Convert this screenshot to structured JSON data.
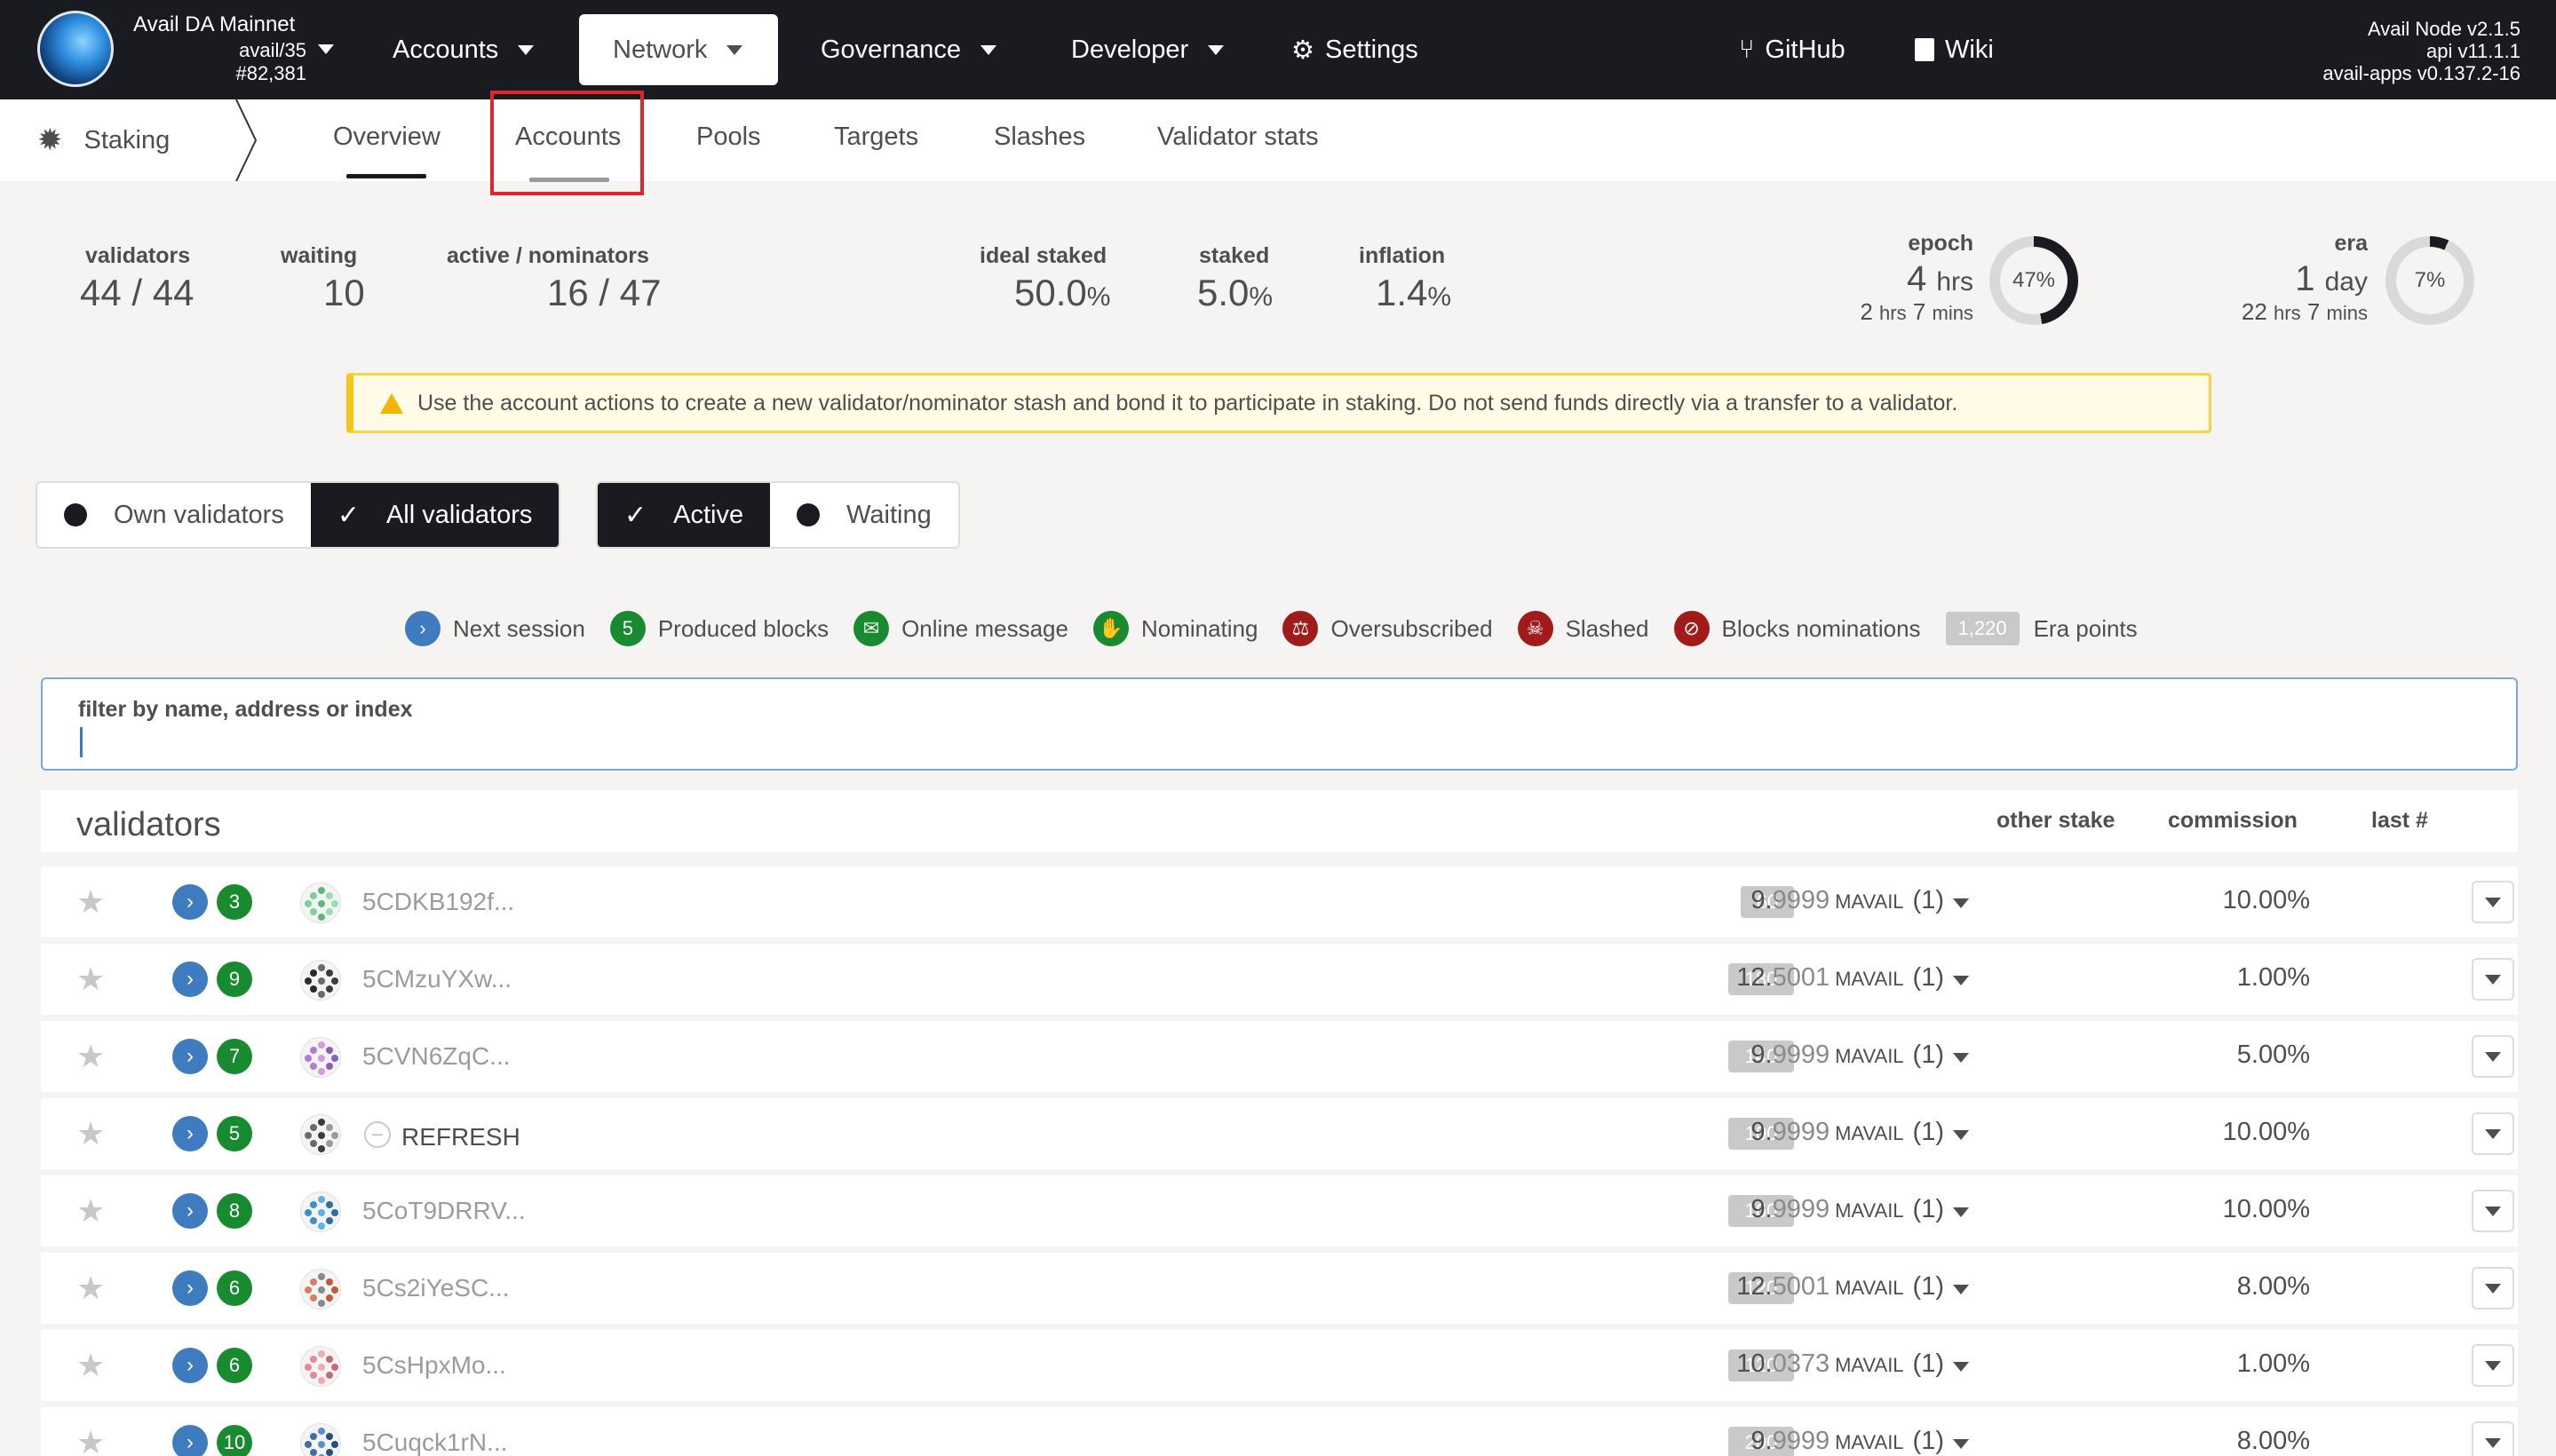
{
  "topbar": {
    "chain_name": "Avail DA Mainnet",
    "chain_spec": "avail/35",
    "block": "#82,381",
    "menu": {
      "accounts": "Accounts",
      "network": "Network",
      "governance": "Governance",
      "developer": "Developer",
      "settings": "Settings",
      "github": "GitHub",
      "wiki": "Wiki"
    },
    "version": {
      "node": "Avail Node v2.1.5",
      "api": "api v11.1.1",
      "apps": "avail-apps v0.137.2-16"
    }
  },
  "subnav": {
    "title": "Staking",
    "tabs": {
      "overview": "Overview",
      "accounts": "Accounts",
      "pools": "Pools",
      "targets": "Targets",
      "slashes": "Slashes",
      "validator_stats": "Validator stats"
    }
  },
  "summary": {
    "validators": {
      "label": "validators",
      "value": "44 / 44"
    },
    "waiting": {
      "label": "waiting",
      "value": "10"
    },
    "active_nominators": {
      "label": "active / nominators",
      "value": "16 / 47"
    },
    "ideal_staked": {
      "label": "ideal staked",
      "value": "50.0",
      "unit": "%"
    },
    "staked": {
      "label": "staked",
      "value": "5.0",
      "unit": "%"
    },
    "inflation": {
      "label": "inflation",
      "value": "1.4",
      "unit": "%"
    },
    "epoch": {
      "label": "epoch",
      "value": "4",
      "unit": "hrs",
      "sub_h": "2",
      "sub_h_unit": "hrs",
      "sub_m": "7",
      "sub_m_unit": "mins",
      "percent_text": "47%",
      "percent": 47
    },
    "era": {
      "label": "era",
      "value": "1",
      "unit": "day",
      "sub_h": "22",
      "sub_h_unit": "hrs",
      "sub_m": "7",
      "sub_m_unit": "mins",
      "percent_text": "7%",
      "percent": 7
    }
  },
  "warning": "Use the account actions to create a new validator/nominator stash and bond it to participate in staking. Do not send funds directly via a transfer to a validator.",
  "toggles": {
    "own_validators": "Own validators",
    "all_validators": "All validators",
    "active": "Active",
    "waiting": "Waiting"
  },
  "legend": {
    "next_session": "Next session",
    "produced_blocks_count": "5",
    "produced_blocks": "Produced blocks",
    "online_message": "Online message",
    "nominating": "Nominating",
    "oversubscribed": "Oversubscribed",
    "slashed": "Slashed",
    "blocks_nominations": "Blocks nominations",
    "era_points_sample": "1,220",
    "era_points": "Era points"
  },
  "filter": {
    "label": "filter by name, address or index"
  },
  "table": {
    "title": "validators",
    "headers": {
      "other_stake": "other stake",
      "commission": "commission",
      "last": "last #"
    },
    "rows": [
      {
        "blocks": "3",
        "name": "5CDKB192f...",
        "era_points": "60",
        "stake_int": "9.",
        "stake_dec": "9999",
        "unit": "MAVAIL",
        "count": "(1)",
        "commission": "10.00%"
      },
      {
        "blocks": "9",
        "name": "5CMzuYXw...",
        "era_points": "180",
        "stake_int": "12.",
        "stake_dec": "5001",
        "unit": "MAVAIL",
        "count": "(1)",
        "commission": "1.00%"
      },
      {
        "blocks": "7",
        "name": "5CVN6ZqC...",
        "era_points": "140",
        "stake_int": "9.",
        "stake_dec": "9999",
        "unit": "MAVAIL",
        "count": "(1)",
        "commission": "5.00%"
      },
      {
        "blocks": "5",
        "name": "REFRESH",
        "era_points": "100",
        "stake_int": "9.",
        "stake_dec": "9999",
        "unit": "MAVAIL",
        "count": "(1)",
        "commission": "10.00%"
      },
      {
        "blocks": "8",
        "name": "5CoT9DRRV...",
        "era_points": "160",
        "stake_int": "9.",
        "stake_dec": "9999",
        "unit": "MAVAIL",
        "count": "(1)",
        "commission": "10.00%"
      },
      {
        "blocks": "6",
        "name": "5Cs2iYeSC...",
        "era_points": "120",
        "stake_int": "12.",
        "stake_dec": "5001",
        "unit": "MAVAIL",
        "count": "(1)",
        "commission": "8.00%"
      },
      {
        "blocks": "6",
        "name": "5CsHpxMo...",
        "era_points": "120",
        "stake_int": "10.",
        "stake_dec": "0373",
        "unit": "MAVAIL",
        "count": "(1)",
        "commission": "1.00%"
      },
      {
        "blocks": "10",
        "name": "5Cuqck1rN...",
        "era_points": "200",
        "stake_int": "9.",
        "stake_dec": "9999",
        "unit": "MAVAIL",
        "count": "(1)",
        "commission": "8.00%"
      }
    ]
  },
  "colors": {
    "topbar": "#1a1b20",
    "accent_blue": "#3f7bbf",
    "green": "#188a2f",
    "red": "#a11b1b",
    "warning_border": "#f5d547",
    "highlight": "#e0262b"
  }
}
